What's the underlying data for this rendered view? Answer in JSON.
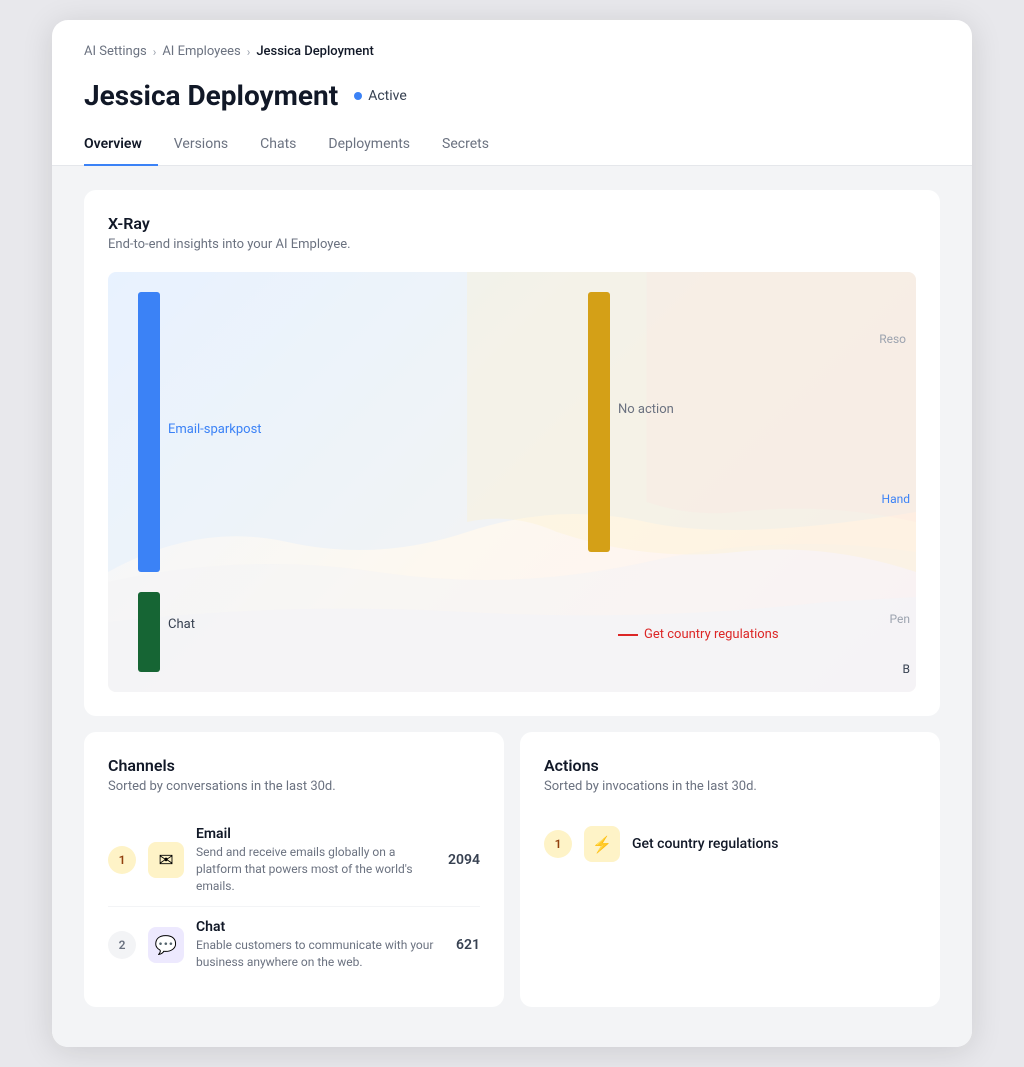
{
  "breadcrumb": {
    "items": [
      "AI Settings",
      "AI Employees",
      "Jessica Deployment"
    ]
  },
  "page": {
    "title": "Jessica Deployment",
    "status": "Active"
  },
  "tabs": [
    {
      "label": "Overview",
      "active": true
    },
    {
      "label": "Versions",
      "active": false
    },
    {
      "label": "Chats",
      "active": false
    },
    {
      "label": "Deployments",
      "active": false
    },
    {
      "label": "Secrets",
      "active": false
    }
  ],
  "xray": {
    "title": "X-Ray",
    "subtitle": "End-to-end insights into your AI Employee.",
    "labels": {
      "email": "Email-sparkpost",
      "noaction": "No action",
      "chat": "Chat",
      "getcountry": "Get country regulations",
      "reso": "Reso",
      "hand": "Hand",
      "pen": "Pen",
      "b": "B"
    }
  },
  "channels": {
    "title": "Channels",
    "subtitle": "Sorted by conversations in the last 30d.",
    "items": [
      {
        "rank": "1",
        "name": "Email",
        "desc": "Send and receive emails globally on a platform that powers most of the world's emails.",
        "count": "2094",
        "icon": "✉"
      },
      {
        "rank": "2",
        "name": "Chat",
        "desc": "Enable customers to communicate with your business anywhere on the web.",
        "count": "621",
        "icon": "💬"
      }
    ]
  },
  "actions": {
    "title": "Actions",
    "subtitle": "Sorted by invocations in the last 30d.",
    "items": [
      {
        "rank": "1",
        "name": "Get country regulations",
        "icon": "⚡"
      }
    ]
  }
}
